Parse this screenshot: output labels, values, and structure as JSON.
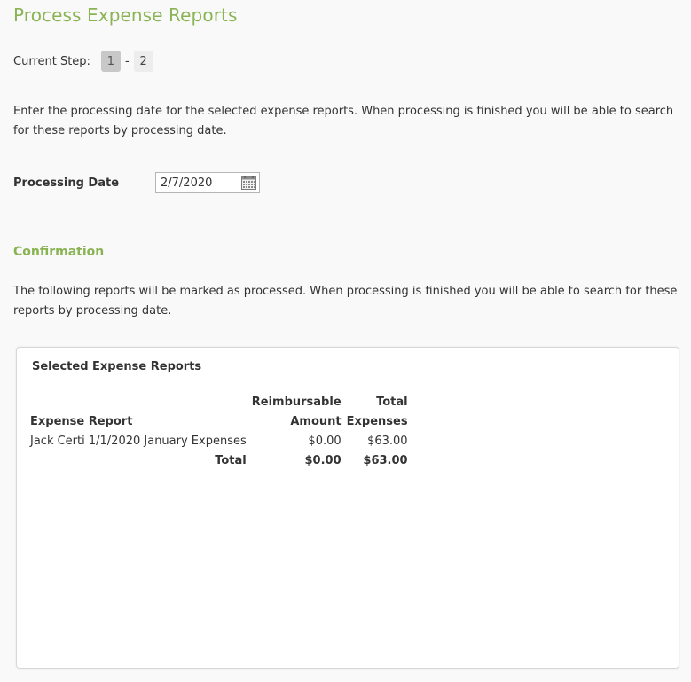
{
  "page": {
    "title": "Process Expense Reports"
  },
  "steps": {
    "label": "Current Step:",
    "items": [
      "1",
      "2"
    ],
    "separator": "-",
    "active": "1"
  },
  "instructions": "Enter the processing date for the selected expense reports. When processing is finished you will be able to search for these reports by processing date.",
  "processing_date": {
    "label": "Processing Date",
    "value": "2/7/2020",
    "icon": "calendar-icon"
  },
  "confirmation": {
    "heading": "Confirmation",
    "text": "The following reports will be marked as processed. When processing is finished you will be able to search for these reports by processing date."
  },
  "panel": {
    "title": "Selected Expense Reports",
    "columns": {
      "report": "Expense Report",
      "reimbursable_top": "Reimbursable",
      "reimbursable_bottom": "Amount",
      "total_top": "Total",
      "total_bottom": "Expenses"
    },
    "rows": [
      {
        "report": "Jack Certi 1/1/2020 January Expenses",
        "reimbursable": "$0.00",
        "total": "$63.00"
      }
    ],
    "totals": {
      "label": "Total",
      "reimbursable": "$0.00",
      "total": "$63.00"
    }
  },
  "colors": {
    "accent": "#8ab454",
    "text": "#333333",
    "background": "#f9f9f9"
  }
}
